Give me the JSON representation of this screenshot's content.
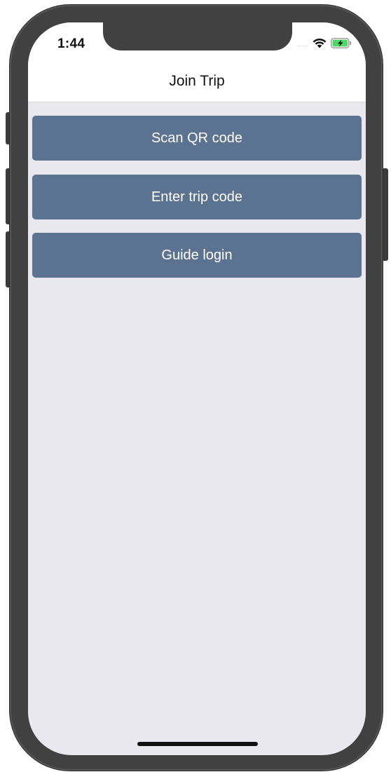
{
  "status_bar": {
    "time": "1:44",
    "signal_dots": "....",
    "wifi_icon": "wifi-icon",
    "battery_icon": "battery-charging-icon",
    "battery_color": "#4cd964"
  },
  "nav": {
    "title": "Join Trip"
  },
  "actions": {
    "scan_qr_label": "Scan QR code",
    "enter_code_label": "Enter trip code",
    "guide_login_label": "Guide login"
  },
  "colors": {
    "button_bg": "#5b7291",
    "screen_bg": "#e9e8ef",
    "bezel": "#414141"
  }
}
